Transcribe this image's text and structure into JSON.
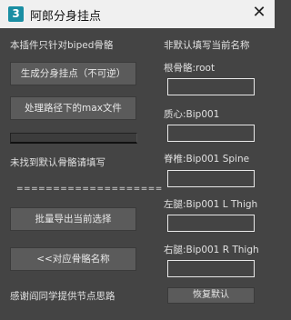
{
  "window": {
    "app_icon_text": "3",
    "title": "阿郎分身挂点",
    "close_glyph": "✕"
  },
  "left": {
    "info_label": "本插件只针对biped骨骼",
    "btn_generate": "生成分身挂点（不可逆）",
    "btn_process": "处理路径下的max文件",
    "progress": 0,
    "not_found_label": "未找到默认骨骼请填写",
    "separator": "====================",
    "btn_batch_export": "批量导出当前选择",
    "btn_match_names": "<<对应骨骼名称",
    "thanks_label": "感谢阎同学提供节点思路"
  },
  "right": {
    "header": "非默认填写当前名称",
    "fields": [
      {
        "label": "根骨骼:root",
        "value": ""
      },
      {
        "label": "质心:Bip001",
        "value": ""
      },
      {
        "label": "脊椎:Bip001 Spine",
        "value": ""
      },
      {
        "label": "左腿:Bip001 L Thigh",
        "value": ""
      },
      {
        "label": "右腿:Bip001 R Thigh",
        "value": ""
      }
    ],
    "btn_restore": "恢复默认"
  }
}
